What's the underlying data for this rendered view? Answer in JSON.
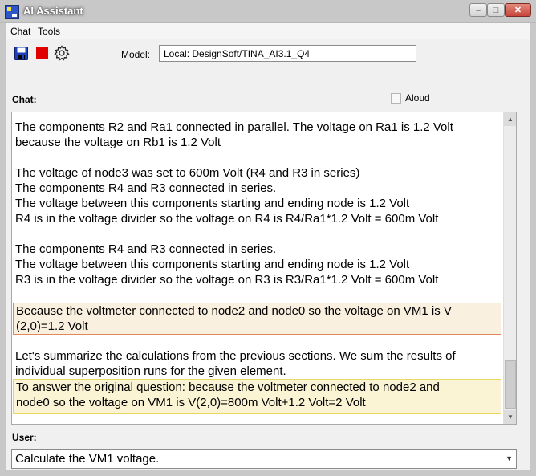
{
  "window": {
    "title": "AI Assistant",
    "minimize_glyph": "–",
    "maximize_glyph": "□",
    "close_glyph": "✕"
  },
  "menu": [
    "Chat",
    "Tools"
  ],
  "toolbar": {
    "icons": [
      "save-icon",
      "stop-icon",
      "settings-icon"
    ],
    "model_label": "Model:",
    "model_value": "Local: DesignSoft/TINA_AI3.1_Q4"
  },
  "chat": {
    "label": "Chat:",
    "aloud_label": "Aloud",
    "aloud_checked": false,
    "paragraphs": [
      {
        "style": "plain",
        "lines": [
          "The components R2 and Ra1 connected in parallel. The voltage on Ra1 is 1.2 Volt",
          "because the voltage on Rb1 is 1.2 Volt"
        ]
      },
      {
        "style": "plain",
        "lines": [
          "The voltage of node3 was set to 600m Volt (R4 and R3 in series)",
          "The components R4 and R3 connected in series.",
          "The voltage between this components starting and ending node is 1.2 Volt",
          "R4 is in the voltage divider so the voltage on R4 is R4/Ra1*1.2 Volt = 600m Volt"
        ]
      },
      {
        "style": "plain",
        "lines": [
          "The components R4 and R3 connected in series.",
          "The voltage between this components starting and ending node is 1.2 Volt",
          "R3 is in the voltage divider so the voltage on R3 is R3/Ra1*1.2 Volt = 600m Volt"
        ]
      },
      {
        "style": "orange-highlight",
        "lines": [
          "Because the voltmeter connected to node2 and node0 so the voltage on VM1 is V",
          "(2,0)=1.2 Volt"
        ]
      },
      {
        "style": "plain",
        "lines": [
          "Let's summarize the calculations from the previous sections. We sum the results of",
          "individual superposition runs for the given element."
        ]
      },
      {
        "style": "yellow-highlight",
        "lines": [
          "To answer the original question: because the voltmeter connected to node2 and",
          "node0 so the voltage on VM1 is V(2,0)=800m Volt+1.2 Volt=2 Volt"
        ]
      }
    ],
    "colors": {
      "orange_bg": "#f9f0e0",
      "orange_border": "#e2885a",
      "yellow_bg": "#fbf4d4",
      "yellow_border": "#e9d763"
    }
  },
  "user": {
    "label": "User:",
    "input_value": "Calculate the VM1 voltage."
  }
}
